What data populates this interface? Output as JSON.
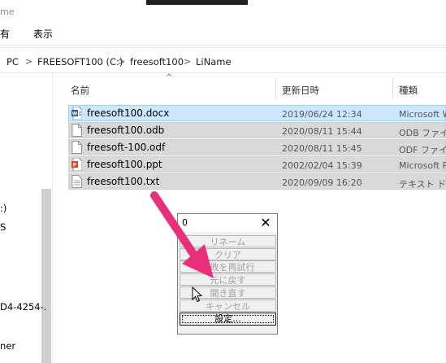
{
  "window": {
    "title_partial": "me"
  },
  "menu": {
    "items": [
      "有",
      "表示"
    ]
  },
  "address": {
    "crumbs": [
      "PC",
      "FREESOFT100 (C:)",
      "freesoft100",
      "LiName"
    ],
    "separator": ">"
  },
  "nav": {
    "items": [
      ":)",
      "S",
      "D4-4254-.",
      "ner"
    ]
  },
  "columns": {
    "name": "名前",
    "modified": "更新日時",
    "type": "種類"
  },
  "files": [
    {
      "name": "freesoft100.docx",
      "date": "2019/06/24 12:34",
      "type": "Microsoft W",
      "icon": "word-icon"
    },
    {
      "name": "freesoft100.odb",
      "date": "2020/08/11 15:44",
      "type": "ODB ファイル",
      "icon": "file-icon"
    },
    {
      "name": "freesoft-100.odf",
      "date": "2020/08/11 15:45",
      "type": "ODF ファイル",
      "icon": "file-icon"
    },
    {
      "name": "freesoft100.ppt",
      "date": "2002/02/04 15:39",
      "type": "Microsoft P",
      "icon": "powerpoint-icon"
    },
    {
      "name": "freesoft100.txt",
      "date": "2020/09/09 16:20",
      "type": "テキスト ドキ",
      "icon": "text-file-icon"
    }
  ],
  "dialog": {
    "title": "0",
    "buttons": [
      "リネーム",
      "クリア",
      "失敗を再試行",
      "元に戻す",
      "開き直す",
      "キャンセル",
      "設定..."
    ]
  },
  "colors": {
    "selection": "#cce8ff",
    "selection_dim": "#d9d9d9",
    "arrow": "#e8307a"
  }
}
